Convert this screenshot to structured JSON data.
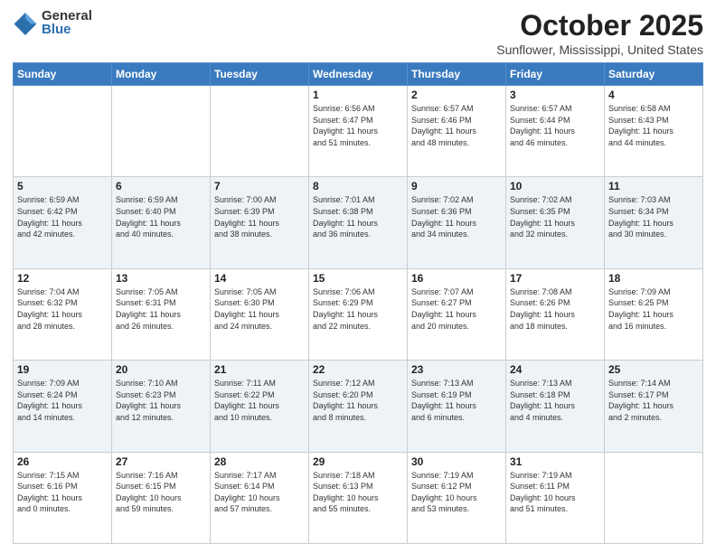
{
  "logo": {
    "general": "General",
    "blue": "Blue"
  },
  "title": "October 2025",
  "subtitle": "Sunflower, Mississippi, United States",
  "days_of_week": [
    "Sunday",
    "Monday",
    "Tuesday",
    "Wednesday",
    "Thursday",
    "Friday",
    "Saturday"
  ],
  "weeks": [
    [
      {
        "day": "",
        "info": ""
      },
      {
        "day": "",
        "info": ""
      },
      {
        "day": "",
        "info": ""
      },
      {
        "day": "1",
        "info": "Sunrise: 6:56 AM\nSunset: 6:47 PM\nDaylight: 11 hours\nand 51 minutes."
      },
      {
        "day": "2",
        "info": "Sunrise: 6:57 AM\nSunset: 6:46 PM\nDaylight: 11 hours\nand 48 minutes."
      },
      {
        "day": "3",
        "info": "Sunrise: 6:57 AM\nSunset: 6:44 PM\nDaylight: 11 hours\nand 46 minutes."
      },
      {
        "day": "4",
        "info": "Sunrise: 6:58 AM\nSunset: 6:43 PM\nDaylight: 11 hours\nand 44 minutes."
      }
    ],
    [
      {
        "day": "5",
        "info": "Sunrise: 6:59 AM\nSunset: 6:42 PM\nDaylight: 11 hours\nand 42 minutes."
      },
      {
        "day": "6",
        "info": "Sunrise: 6:59 AM\nSunset: 6:40 PM\nDaylight: 11 hours\nand 40 minutes."
      },
      {
        "day": "7",
        "info": "Sunrise: 7:00 AM\nSunset: 6:39 PM\nDaylight: 11 hours\nand 38 minutes."
      },
      {
        "day": "8",
        "info": "Sunrise: 7:01 AM\nSunset: 6:38 PM\nDaylight: 11 hours\nand 36 minutes."
      },
      {
        "day": "9",
        "info": "Sunrise: 7:02 AM\nSunset: 6:36 PM\nDaylight: 11 hours\nand 34 minutes."
      },
      {
        "day": "10",
        "info": "Sunrise: 7:02 AM\nSunset: 6:35 PM\nDaylight: 11 hours\nand 32 minutes."
      },
      {
        "day": "11",
        "info": "Sunrise: 7:03 AM\nSunset: 6:34 PM\nDaylight: 11 hours\nand 30 minutes."
      }
    ],
    [
      {
        "day": "12",
        "info": "Sunrise: 7:04 AM\nSunset: 6:32 PM\nDaylight: 11 hours\nand 28 minutes."
      },
      {
        "day": "13",
        "info": "Sunrise: 7:05 AM\nSunset: 6:31 PM\nDaylight: 11 hours\nand 26 minutes."
      },
      {
        "day": "14",
        "info": "Sunrise: 7:05 AM\nSunset: 6:30 PM\nDaylight: 11 hours\nand 24 minutes."
      },
      {
        "day": "15",
        "info": "Sunrise: 7:06 AM\nSunset: 6:29 PM\nDaylight: 11 hours\nand 22 minutes."
      },
      {
        "day": "16",
        "info": "Sunrise: 7:07 AM\nSunset: 6:27 PM\nDaylight: 11 hours\nand 20 minutes."
      },
      {
        "day": "17",
        "info": "Sunrise: 7:08 AM\nSunset: 6:26 PM\nDaylight: 11 hours\nand 18 minutes."
      },
      {
        "day": "18",
        "info": "Sunrise: 7:09 AM\nSunset: 6:25 PM\nDaylight: 11 hours\nand 16 minutes."
      }
    ],
    [
      {
        "day": "19",
        "info": "Sunrise: 7:09 AM\nSunset: 6:24 PM\nDaylight: 11 hours\nand 14 minutes."
      },
      {
        "day": "20",
        "info": "Sunrise: 7:10 AM\nSunset: 6:23 PM\nDaylight: 11 hours\nand 12 minutes."
      },
      {
        "day": "21",
        "info": "Sunrise: 7:11 AM\nSunset: 6:22 PM\nDaylight: 11 hours\nand 10 minutes."
      },
      {
        "day": "22",
        "info": "Sunrise: 7:12 AM\nSunset: 6:20 PM\nDaylight: 11 hours\nand 8 minutes."
      },
      {
        "day": "23",
        "info": "Sunrise: 7:13 AM\nSunset: 6:19 PM\nDaylight: 11 hours\nand 6 minutes."
      },
      {
        "day": "24",
        "info": "Sunrise: 7:13 AM\nSunset: 6:18 PM\nDaylight: 11 hours\nand 4 minutes."
      },
      {
        "day": "25",
        "info": "Sunrise: 7:14 AM\nSunset: 6:17 PM\nDaylight: 11 hours\nand 2 minutes."
      }
    ],
    [
      {
        "day": "26",
        "info": "Sunrise: 7:15 AM\nSunset: 6:16 PM\nDaylight: 11 hours\nand 0 minutes."
      },
      {
        "day": "27",
        "info": "Sunrise: 7:16 AM\nSunset: 6:15 PM\nDaylight: 10 hours\nand 59 minutes."
      },
      {
        "day": "28",
        "info": "Sunrise: 7:17 AM\nSunset: 6:14 PM\nDaylight: 10 hours\nand 57 minutes."
      },
      {
        "day": "29",
        "info": "Sunrise: 7:18 AM\nSunset: 6:13 PM\nDaylight: 10 hours\nand 55 minutes."
      },
      {
        "day": "30",
        "info": "Sunrise: 7:19 AM\nSunset: 6:12 PM\nDaylight: 10 hours\nand 53 minutes."
      },
      {
        "day": "31",
        "info": "Sunrise: 7:19 AM\nSunset: 6:11 PM\nDaylight: 10 hours\nand 51 minutes."
      },
      {
        "day": "",
        "info": ""
      }
    ]
  ]
}
